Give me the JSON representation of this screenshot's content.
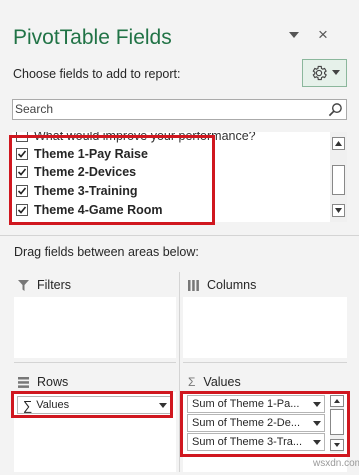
{
  "pane": {
    "title": "PivotTable Fields",
    "choose_label": "Choose fields to add to report:",
    "search_placeholder": "Search",
    "close_glyph": "×"
  },
  "fields": [
    {
      "label": "What would improve your performance?",
      "checked": false
    },
    {
      "label": "Theme 1-Pay Raise",
      "checked": true
    },
    {
      "label": "Theme 2-Devices",
      "checked": true
    },
    {
      "label": "Theme 3-Training",
      "checked": true
    },
    {
      "label": "Theme 4-Game Room",
      "checked": true
    }
  ],
  "areas": {
    "drag_label": "Drag fields between areas below:",
    "filters": {
      "label": "Filters"
    },
    "columns": {
      "label": "Columns"
    },
    "rows": {
      "label": "Rows",
      "items": [
        {
          "sigma": "∑",
          "label": "Values"
        }
      ]
    },
    "values": {
      "sigma": "Σ",
      "label": "Values",
      "items": [
        {
          "label": "Sum of Theme 1-Pa..."
        },
        {
          "label": "Sum of Theme 2-De..."
        },
        {
          "label": "Sum of Theme 3-Tra..."
        }
      ]
    }
  },
  "colors": {
    "accent": "#217346",
    "highlight": "#d0171f"
  },
  "watermark": "wsxdn.com"
}
